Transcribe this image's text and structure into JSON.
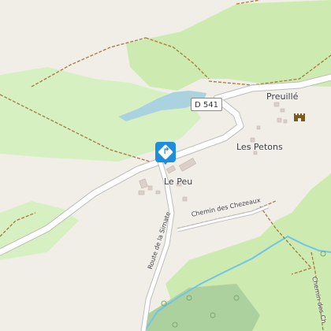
{
  "map": {
    "labels": {
      "road_shield": "D 541",
      "preuille": "Preuillé",
      "les_petons": "Les Petons",
      "le_peu": "Le Peu",
      "chemin_chezeaux": "Chemin des Chezeaux",
      "route_simate": "Route de la Simate",
      "chemin_partial": "Chemin des Ch"
    },
    "icons": {
      "poi_marker": "directions-diamond-icon",
      "castle": "castle-icon"
    },
    "colors": {
      "background": "#f1eee8",
      "forest": "#cdebb0",
      "meadow": "#d7f0c2",
      "water": "#aad3df",
      "stream": "#72c4e6",
      "road_fill": "#ffffff",
      "road_casing": "#bdbdbd",
      "track": "#a8763e",
      "building": "#d9d0c9",
      "marker": "#1e8de0"
    }
  }
}
